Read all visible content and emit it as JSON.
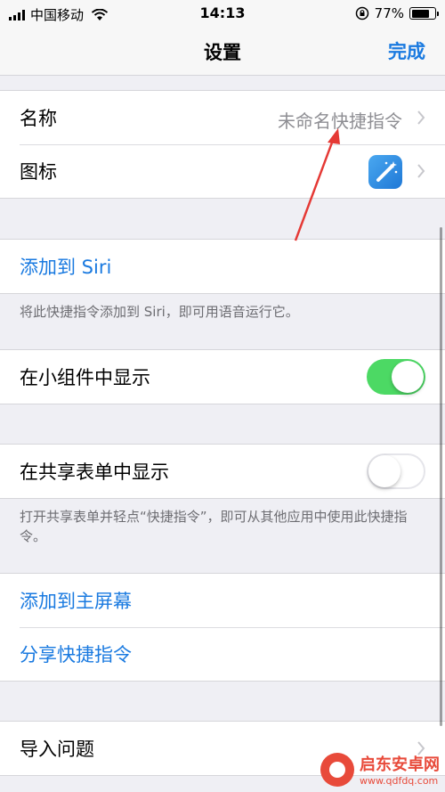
{
  "status_bar": {
    "carrier": "中国移动",
    "time": "14:13",
    "battery": "77%",
    "battery_level": 0.77
  },
  "nav": {
    "title": "设置",
    "done_label": "完成"
  },
  "section_name_icon": {
    "name_label": "名称",
    "name_value": "未命名快捷指令",
    "icon_label": "图标",
    "icon_name": "magic-wand-icon"
  },
  "section_siri": {
    "add_label": "添加到 Siri",
    "footnote": "将此快捷指令添加到 Siri，即可用语音运行它。"
  },
  "section_widget": {
    "label": "在小组件中显示",
    "toggle_on": true
  },
  "section_share": {
    "label": "在共享表单中显示",
    "toggle_on": false,
    "footnote": "打开共享表单并轻点“快捷指令”，即可从其他应用中使用此快捷指令。"
  },
  "section_actions": {
    "add_home": "添加到主屏幕",
    "share": "分享快捷指令"
  },
  "section_import": {
    "label": "导入问题"
  },
  "watermark": {
    "title": "启东安卓网",
    "url": "www.qdfdq.com"
  },
  "colors": {
    "accent": "#1a7ae0",
    "toggle_on": "#4cd964",
    "annotation": "#e53935",
    "watermark": "#e84a3a"
  }
}
